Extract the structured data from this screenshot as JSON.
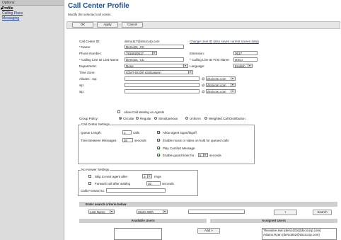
{
  "sidebar": {
    "header": "Options:",
    "items": [
      {
        "label": "Profile",
        "active": true
      },
      {
        "label": "Calling Plans",
        "active": false
      },
      {
        "label": "Messaging",
        "active": false
      }
    ]
  },
  "page": {
    "title": "Call Center Profile",
    "subtitle": "Modify the selected call center."
  },
  "toolbar": {
    "ok_label": "OK",
    "apply_label": "Apply",
    "cancel_label": "Cancel"
  },
  "form": {
    "call_center_id_label": "Call Center ID:",
    "call_center_id_value": "demo117@dscicorp.com",
    "change_user_id_link": "Change User ID (also saves current screen data)",
    "name_label": "* Name:",
    "name_value": "Demo01_CC",
    "phone_label": "Phone Number:",
    "phone_value": "7816020517",
    "extension_label": "Extension:",
    "extension_value": "0517",
    "clid_last_label": "* Calling Line ID Last Name:",
    "clid_last_value": "Demo01_CC",
    "clid_first_label": "* Calling Line ID First Name:",
    "clid_first_value": "DSCI",
    "department_label": "Department:",
    "department_value": "None",
    "language_label": "Language:",
    "language_value": "English",
    "timezone_label": "Time Zone:",
    "timezone_value": "(GMT-04:00) US/Eastern",
    "aliases_label": "Aliases : sip:",
    "sip_label": "sip:",
    "sip2_label": "sip:",
    "at_sign": "@",
    "domain_value": "dscicorp.com",
    "allow_waiting_label": "Allow Call Waiting on Agents",
    "group_policy_label": "Group Policy:",
    "policies": [
      "Circular",
      "Regular",
      "Simultaneous",
      "Uniform",
      "Weighted Call Distribution"
    ],
    "policy_selected": "Circular"
  },
  "call_center_settings": {
    "legend": "Call Center Settings",
    "queue_length_label": "Queue Length:",
    "queue_length_value": "1",
    "queue_length_unit": "calls",
    "time_between_label": "Time Between Messages:",
    "time_between_value": "30",
    "time_between_unit": "seconds",
    "allow_logon_label": "Allow agent logon/logoff",
    "enable_music_label": "Enable music or video on hold for queued calls",
    "play_comfort_label": "Play Comfort Message",
    "guard_timer_label": "Enable guard timer for",
    "guard_timer_value": "5",
    "guard_timer_unit": "seconds"
  },
  "no_answer_settings": {
    "legend": "No Answer Settings",
    "skip_label": "Skip to next agent after",
    "skip_value": "3",
    "skip_unit": "rings",
    "forward_label": "Forward call after waiting",
    "forward_value": "30",
    "forward_unit": "seconds",
    "calls_forward_label": "Calls Forward to:",
    "calls_forward_value": ""
  },
  "search": {
    "header": "Enter search criteria below",
    "field_value": "Last Name",
    "mode_value": "Starts With",
    "query_value": "",
    "plus_label": "+",
    "search_label": "Search"
  },
  "users": {
    "available_header": "Available Users",
    "assigned_header": "Assigned Users",
    "add_label": "Add >",
    "assigned": [
      "Thevaline,Hal (demo102@dscicorp.com)",
      "Adams,Ryan (demo552@dscicorp.com)"
    ]
  }
}
